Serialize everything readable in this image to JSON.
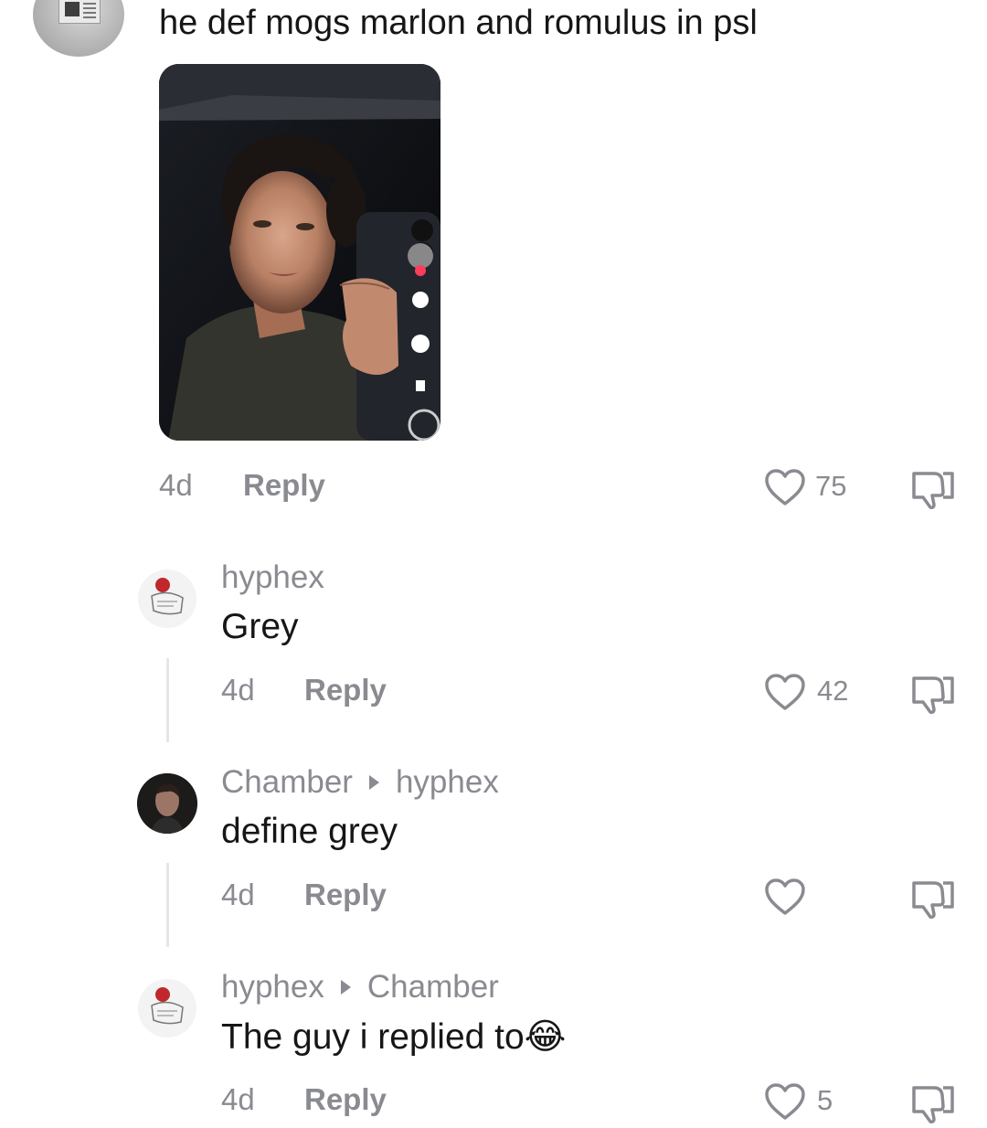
{
  "comment": {
    "text": "he def mogs marlon and romulus in psl",
    "time": "4d",
    "reply_label": "Reply",
    "like_count": "75"
  },
  "replies": [
    {
      "username": "hyphex",
      "reply_to": "",
      "text": "Grey",
      "time": "4d",
      "reply_label": "Reply",
      "like_count": "42"
    },
    {
      "username": "Chamber",
      "reply_to": "hyphex",
      "text": "define grey",
      "time": "4d",
      "reply_label": "Reply",
      "like_count": ""
    },
    {
      "username": "hyphex",
      "reply_to": "Chamber",
      "text": "The guy i replied to",
      "emoji": "😂",
      "time": "4d",
      "reply_label": "Reply",
      "like_count": "5"
    }
  ],
  "icons": {
    "like": "heart-outline-icon",
    "dislike": "thumbs-down-icon",
    "reply_arrow": "triangle-right-icon"
  },
  "colors": {
    "text_primary": "#161616",
    "text_secondary": "#8a8b91",
    "thread_line": "#e6e6e8",
    "background": "#ffffff"
  }
}
